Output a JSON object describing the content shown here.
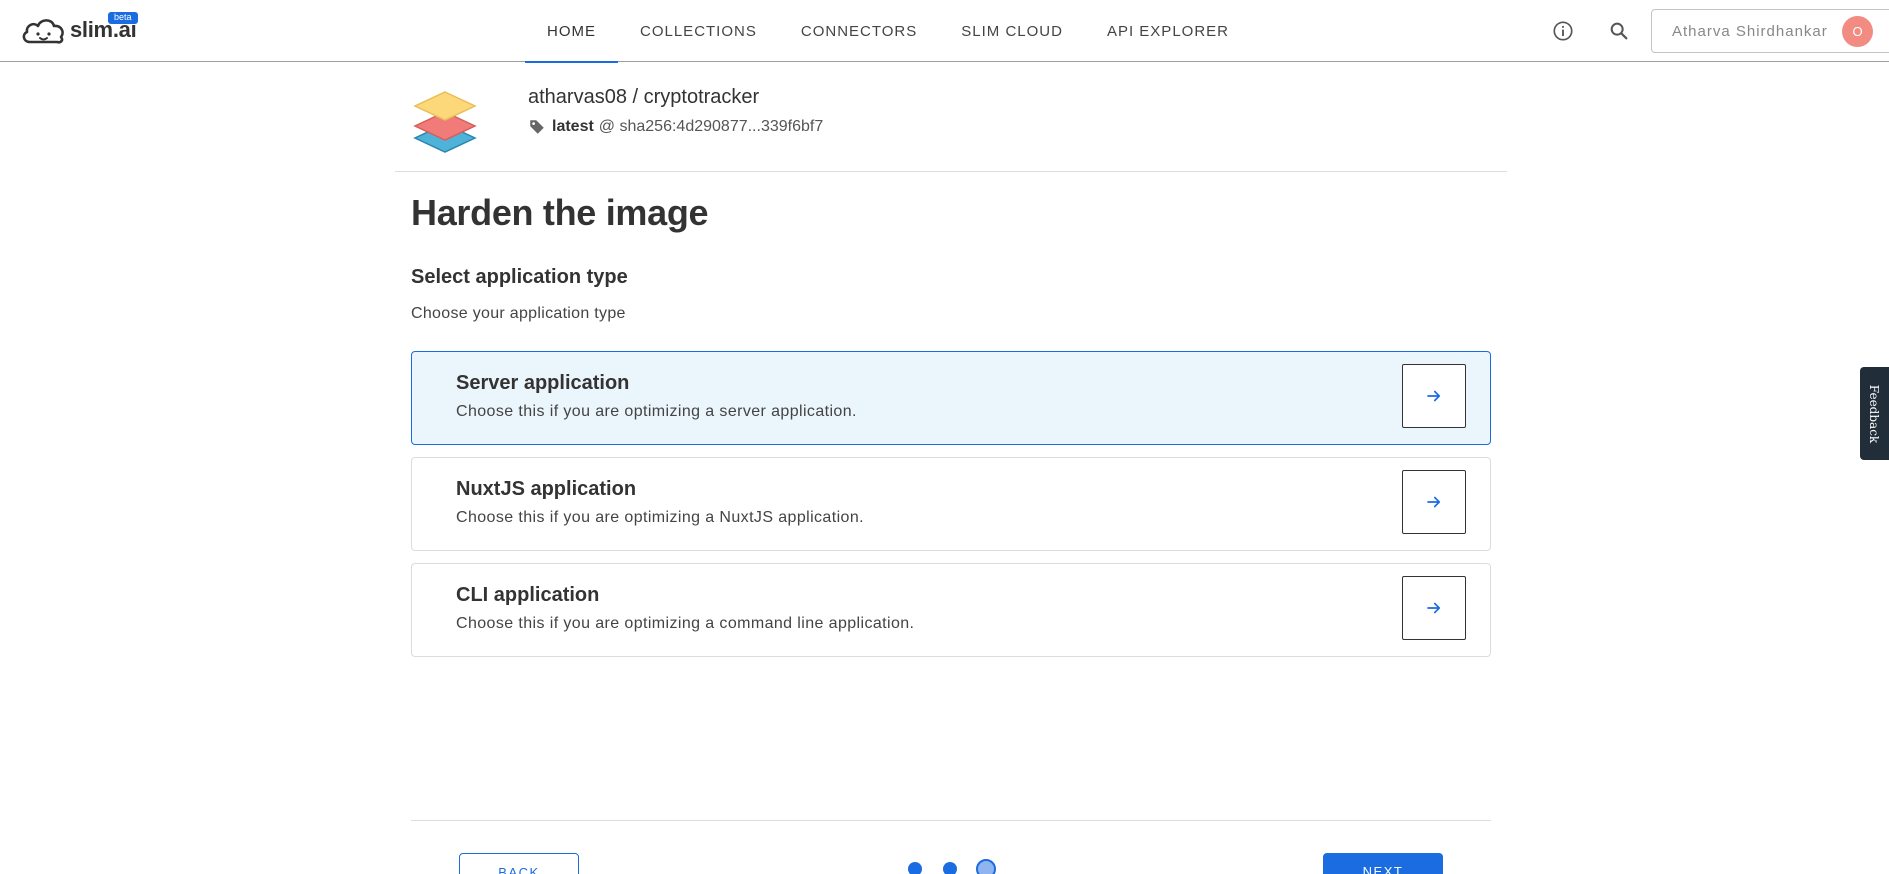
{
  "header": {
    "logo_text": "slim.ai",
    "beta_badge": "beta",
    "nav": [
      {
        "label": "HOME",
        "active": true
      },
      {
        "label": "COLLECTIONS"
      },
      {
        "label": "CONNECTORS"
      },
      {
        "label": "SLIM CLOUD"
      },
      {
        "label": "API EXPLORER"
      }
    ],
    "info_icon": "info-icon",
    "search_icon": "search-icon",
    "user": {
      "name": "Atharva Shirdhankar",
      "avatar_initial": "O"
    }
  },
  "image": {
    "repo": "atharvas08 / cryptotracker",
    "tag": "latest",
    "digest": "@ sha256:4d290877...339f6bf7"
  },
  "main": {
    "title": "Harden the image",
    "section_title": "Select application type",
    "section_subtitle": "Choose your application type",
    "options": [
      {
        "title": "Server application",
        "description": "Choose this if you are optimizing a server application.",
        "selected": true
      },
      {
        "title": "NuxtJS application",
        "description": "Choose this if you are optimizing a NuxtJS application."
      },
      {
        "title": "CLI application",
        "description": "Choose this if you are optimizing a command line application."
      }
    ]
  },
  "footer": {
    "back_label": "BACK",
    "next_label": "NEXT",
    "steps_total": 3,
    "current_step": 3
  },
  "feedback_label": "Feedback",
  "colors": {
    "accent": "#1a6ce0",
    "selected_bg": "#ebf5fc",
    "avatar": "#f28b82"
  }
}
